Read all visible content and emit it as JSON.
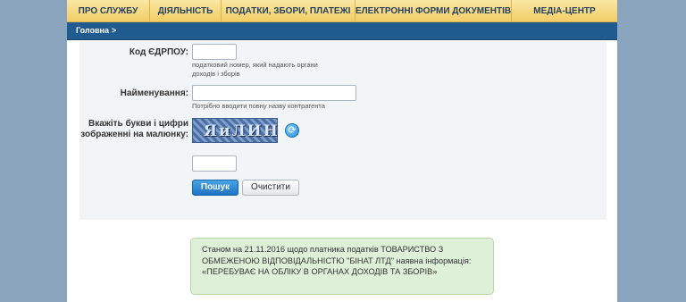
{
  "nav": {
    "items": [
      {
        "label": "ПРО СЛУЖБУ"
      },
      {
        "label": "ДІЯЛЬНІСТЬ"
      },
      {
        "label": "ПОДАТКИ, ЗБОРИ, ПЛАТЕЖІ"
      },
      {
        "label": "ЕЛЕКТРОННІ ФОРМИ ДОКУМЕНТІВ"
      },
      {
        "label": "МЕДІА-ЦЕНТР"
      }
    ]
  },
  "breadcrumb": {
    "home": "Головна",
    "separator": ">"
  },
  "form": {
    "edrpou": {
      "label": "Код ЄДРПОУ:",
      "value": "",
      "hint_line1": "податковий номер, який надають органи",
      "hint_line2": "доходів і зборів"
    },
    "name": {
      "label": "Найменування:",
      "value": "",
      "hint": "Потрібно вводити повну назву контрагента"
    },
    "captcha": {
      "label_line1": "Вкажіть букви і цифри",
      "label_line2": "зображенні на малюнку:",
      "image_text": "ЯиЛИН",
      "value": ""
    },
    "search_button": "Пошук",
    "clear_button": "Очистити"
  },
  "result": {
    "line1": "Станом на 21.11.2016 щодо платника податків ТОВАРИСТВО З",
    "line2": "ОБМЕЖЕНОЮ ВІДПОВІДАЛЬНІСТЮ \"БІНАТ ЛТД\" наявна інформація:",
    "line3": "«ПЕРЕБУВАЄ НА ОБЛІКУ В ОРГАНАХ ДОХОДІВ ТА ЗБОРІВ»"
  },
  "colors": {
    "nav_bg": "#f2cd66",
    "breadcrumb_bg": "#1f5b8e",
    "result_bg": "#dff0d8",
    "primary_button": "#1c74c4"
  }
}
